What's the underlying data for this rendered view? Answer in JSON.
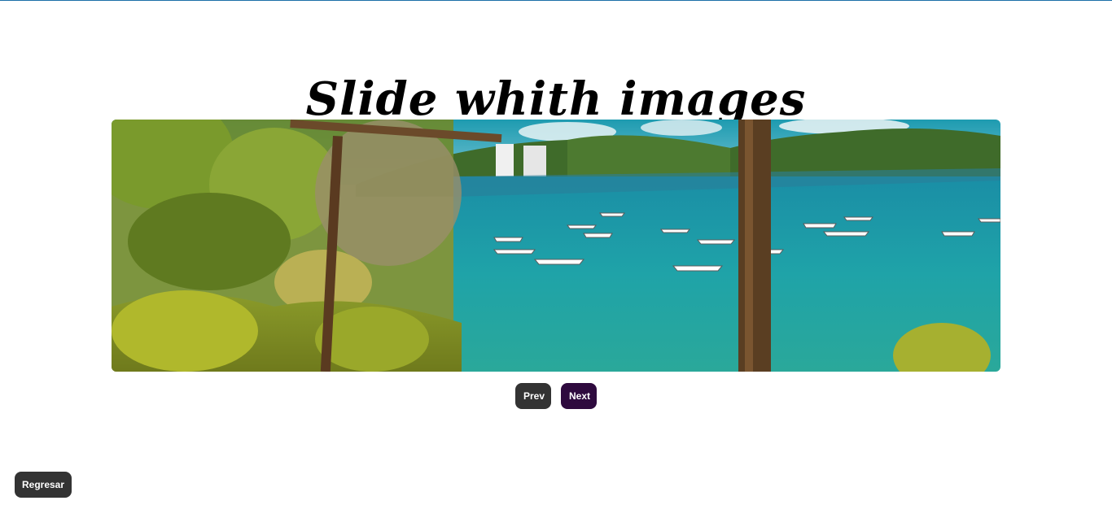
{
  "header": {
    "title": "Slide whith images"
  },
  "slider": {
    "image_description_icon": "beach-landscape-image"
  },
  "controls": {
    "prev_label": "Prev",
    "next_label": "Next"
  },
  "footer": {
    "back_label": "Regresar"
  },
  "colors": {
    "top_border": "#1b6fa8",
    "prev_button": "#333333",
    "next_button": "#2e0a3e",
    "back_button": "#333333"
  }
}
